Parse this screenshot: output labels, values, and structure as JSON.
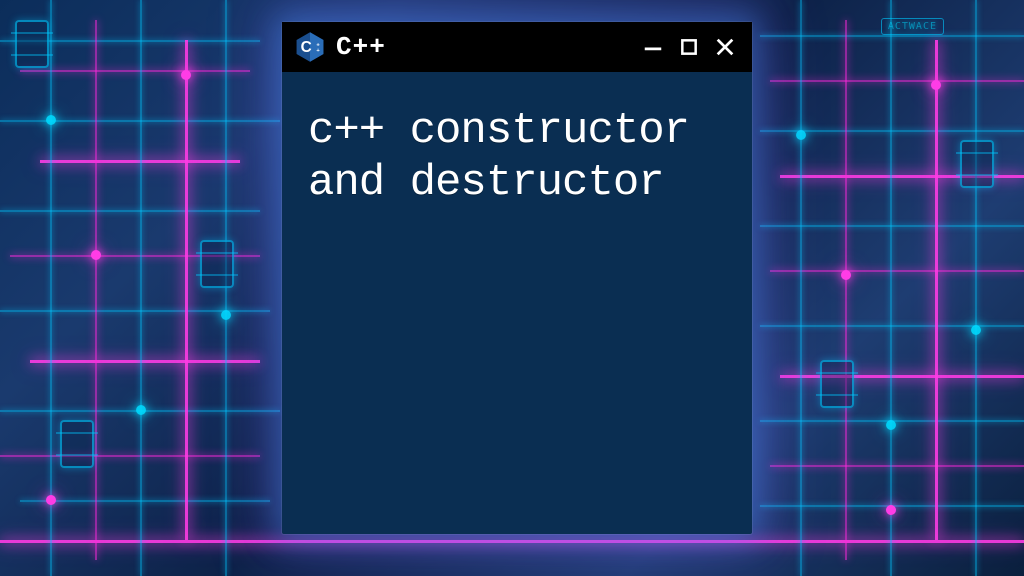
{
  "window": {
    "title": "C++",
    "logo_letter": "C",
    "logo_plus": "++",
    "controls": {
      "minimize": "minimize",
      "maximize": "maximize",
      "close": "close"
    }
  },
  "content": {
    "heading": "c++ constructor and destructor"
  },
  "background": {
    "badge_text": "ACTWACE"
  },
  "colors": {
    "window_bg": "#0a2e52",
    "titlebar_bg": "#000000",
    "text": "#ffffff",
    "neon_cyan": "#00dcff",
    "neon_pink": "#ff3ce6"
  }
}
